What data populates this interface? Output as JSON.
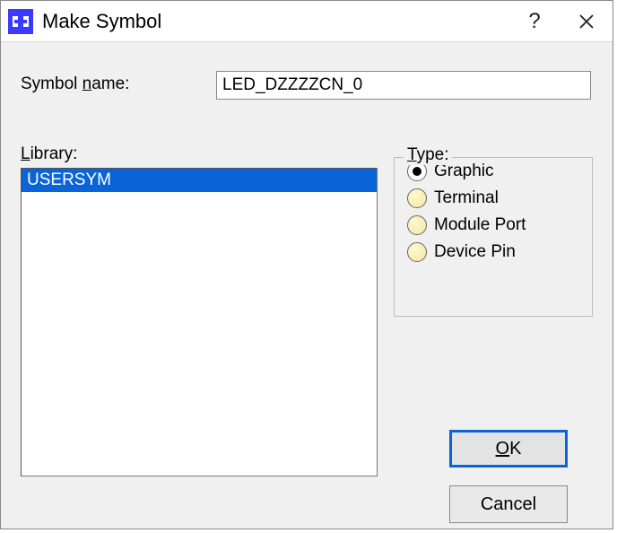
{
  "title": "Make Symbol",
  "labels": {
    "symbol_name_pre": "Symbol ",
    "symbol_name_ul": "n",
    "symbol_name_post": "ame:",
    "library_ul": "L",
    "library_post": "ibrary:",
    "type_ul": "T",
    "type_post": "ype:"
  },
  "fields": {
    "symbol_name": "LED_DZZZZCN_0"
  },
  "library": {
    "items": [
      "USERSYM"
    ],
    "selected": 0
  },
  "type": {
    "options": [
      "Graphic",
      "Terminal",
      "Module Port",
      "Device Pin"
    ],
    "selected": 0
  },
  "buttons": {
    "ok_ul": "O",
    "ok_post": "K",
    "cancel": "Cancel"
  }
}
